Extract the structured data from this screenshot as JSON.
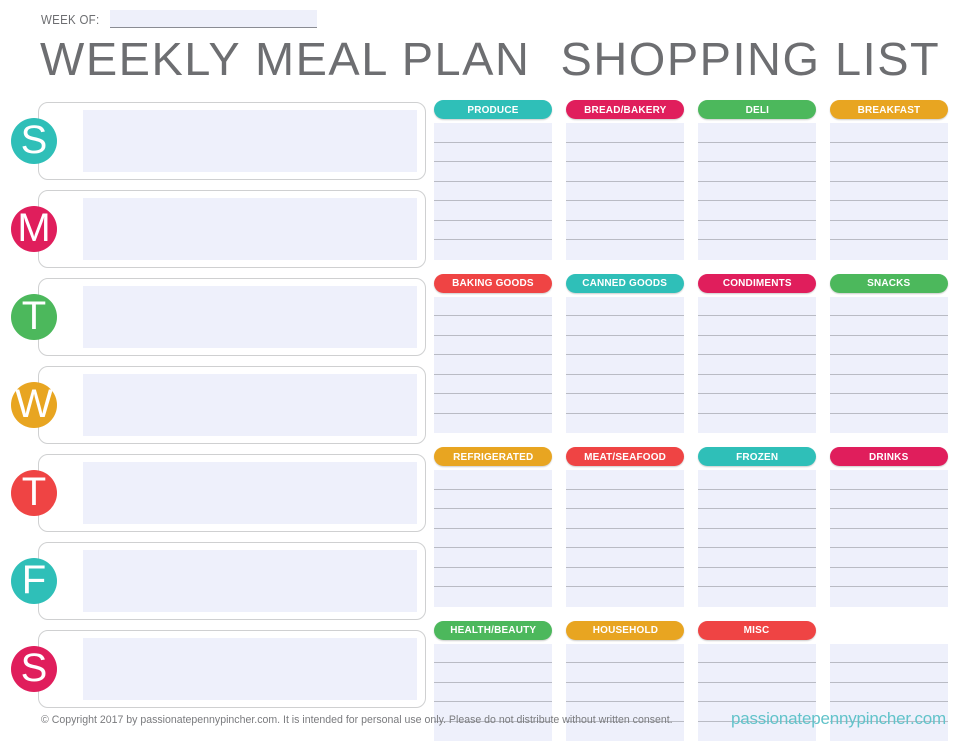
{
  "colors": {
    "teal": "#2fbfb8",
    "pink": "#e01e5c",
    "green": "#4cb85c",
    "orange": "#e8a521",
    "red": "#ef4444",
    "brand_teal": "#62c3ca",
    "fill_lavender": "#eef0fb",
    "line_gray": "#b9bbc4",
    "text_gray": "#6d6e71"
  },
  "header": {
    "week_of_label": "WEEK OF:",
    "week_of_value": "",
    "meal_plan_title": "WEEKLY MEAL PLAN",
    "shopping_list_title": "SHOPPING LIST"
  },
  "meal_plan": {
    "days": [
      {
        "letter": "S",
        "day": "Sunday",
        "color": "#2fbfb8",
        "value": ""
      },
      {
        "letter": "M",
        "day": "Monday",
        "color": "#e01e5c",
        "value": ""
      },
      {
        "letter": "T",
        "day": "Tuesday",
        "color": "#4cb85c",
        "value": ""
      },
      {
        "letter": "W",
        "day": "Wednesday",
        "color": "#e8a521",
        "value": ""
      },
      {
        "letter": "T",
        "day": "Thursday",
        "color": "#ef4444",
        "value": ""
      },
      {
        "letter": "F",
        "day": "Friday",
        "color": "#2fbfb8",
        "value": ""
      },
      {
        "letter": "S",
        "day": "Saturday",
        "color": "#e01e5c",
        "value": ""
      }
    ]
  },
  "shopping_list": {
    "rows": [
      {
        "lines": 7,
        "categories": [
          {
            "label": "PRODUCE",
            "color": "#2fbfb8"
          },
          {
            "label": "BREAD/BAKERY",
            "color": "#e01e5c"
          },
          {
            "label": "DELI",
            "color": "#4cb85c"
          },
          {
            "label": "BREAKFAST",
            "color": "#e8a521"
          }
        ]
      },
      {
        "lines": 7,
        "categories": [
          {
            "label": "BAKING GOODS",
            "color": "#ef4444"
          },
          {
            "label": "CANNED GOODS",
            "color": "#2fbfb8"
          },
          {
            "label": "CONDIMENTS",
            "color": "#e01e5c"
          },
          {
            "label": "SNACKS",
            "color": "#4cb85c"
          }
        ]
      },
      {
        "lines": 7,
        "categories": [
          {
            "label": "REFRIGERATED",
            "color": "#e8a521"
          },
          {
            "label": "MEAT/SEAFOOD",
            "color": "#ef4444"
          },
          {
            "label": "FROZEN",
            "color": "#2fbfb8"
          },
          {
            "label": "DRINKS",
            "color": "#e01e5c"
          }
        ]
      },
      {
        "lines": 5,
        "categories": [
          {
            "label": "HEALTH/BEAUTY",
            "color": "#4cb85c"
          },
          {
            "label": "HOUSEHOLD",
            "color": "#e8a521"
          },
          {
            "label": "MISC",
            "color": "#ef4444"
          },
          {
            "label": "",
            "color": ""
          }
        ]
      }
    ]
  },
  "footer": {
    "copyright": "© Copyright 2017 by passionatepennypincher.com. It is intended for personal use only. Please do not distribute without written consent.",
    "brand": "passionatepennypincher.com"
  }
}
